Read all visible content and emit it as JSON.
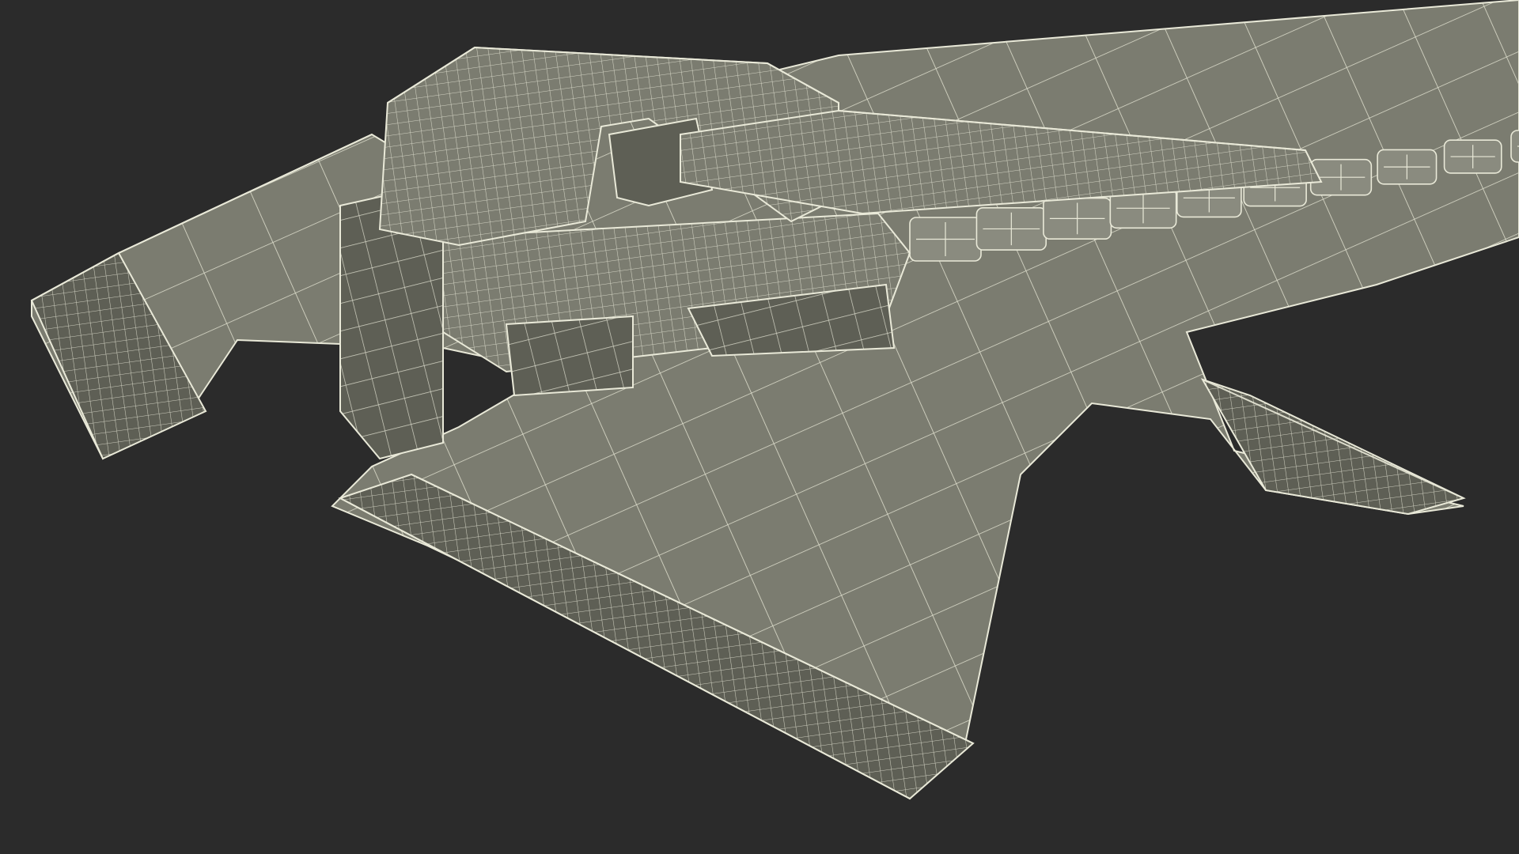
{
  "scene": {
    "subject": "zipper",
    "render_style": "wireframe-over-shaded",
    "colors": {
      "background": "#2b2b2b",
      "surface": "#7b7c70",
      "surface_light": "#8a8b7f",
      "surface_dark": "#5e5f55",
      "wire": "#e9e9d8"
    },
    "teeth_count": 10
  }
}
